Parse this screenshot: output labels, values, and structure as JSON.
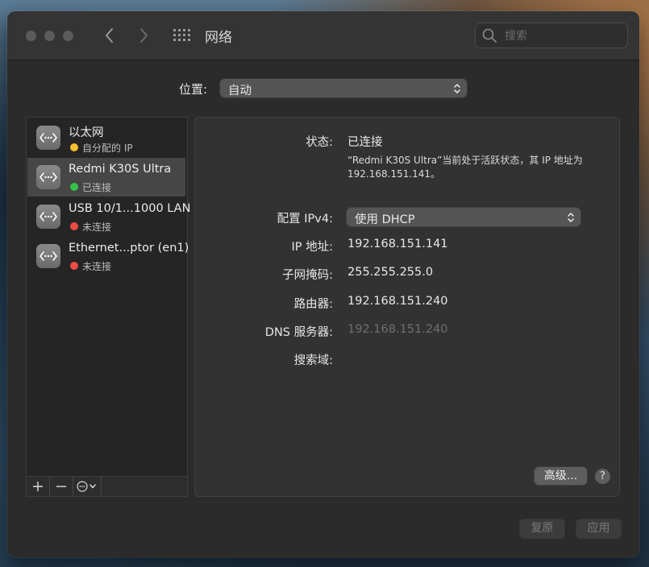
{
  "window": {
    "title": "网络",
    "search": {
      "placeholder": "搜索",
      "value": ""
    }
  },
  "location": {
    "label": "位置:",
    "selected": "自动"
  },
  "services": [
    {
      "name": "以太网",
      "status": "自分配的 IP",
      "status_color": "#f5bf2e",
      "selected": false
    },
    {
      "name": "Redmi K30S Ultra",
      "status": "已连接",
      "status_color": "#33c348",
      "selected": true
    },
    {
      "name": "USB 10/1...1000 LAN",
      "status": "未连接",
      "status_color": "#ee4c43",
      "selected": false
    },
    {
      "name": "Ethernet...ptor (en1)",
      "status": "未连接",
      "status_color": "#ee4c43",
      "selected": false
    }
  ],
  "sidebar_toolbar": {
    "add": "+",
    "remove": "−",
    "action": "⊙⌄"
  },
  "detail": {
    "status_label": "状态:",
    "status_value": "已连接",
    "description": "“Redmi K30S Ultra”当前处于活跃状态，其 IP 地址为 192.168.151.141。",
    "config_label": "配置 IPv4:",
    "config_value": "使用 DHCP",
    "ip_label": "IP 地址:",
    "ip_value": "192.168.151.141",
    "subnet_label": "子网掩码:",
    "subnet_value": "255.255.255.0",
    "router_label": "路由器:",
    "router_value": "192.168.151.240",
    "dns_label": "DNS 服务器:",
    "dns_value": "192.168.151.240",
    "search_domain_label": "搜索域:",
    "search_domain_value": "",
    "advanced_label": "高级...",
    "help_label": "?"
  },
  "footer": {
    "revert_label": "复原",
    "apply_label": "应用"
  }
}
